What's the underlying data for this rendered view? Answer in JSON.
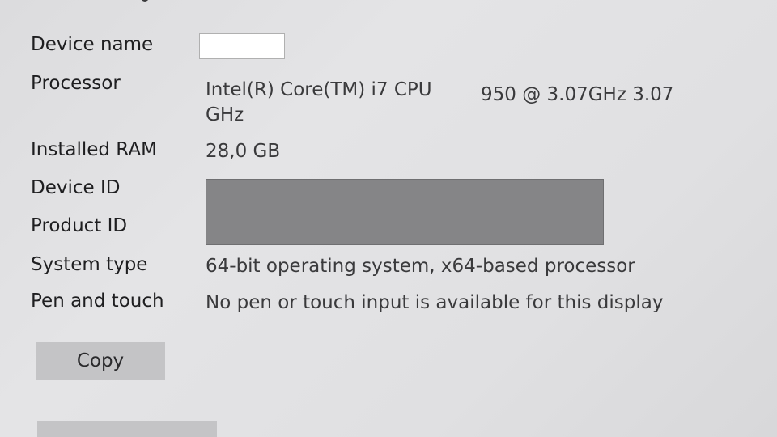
{
  "specs": {
    "device_name": {
      "label": "Device name",
      "value": ""
    },
    "processor": {
      "label": "Processor",
      "value_line1": "Intel(R) Core(TM) i7 CPU",
      "value_suffix": "950  @ 3.07GHz   3.07",
      "value_line2": "GHz"
    },
    "installed_ram": {
      "label": "Installed RAM",
      "value": "28,0 GB"
    },
    "device_id": {
      "label": "Device ID"
    },
    "product_id": {
      "label": "Product ID"
    },
    "system_type": {
      "label": "System type",
      "value": "64-bit operating system, x64-based processor"
    },
    "pen_touch": {
      "label": "Pen and touch",
      "value": "No pen or touch input is available for this display"
    }
  },
  "buttons": {
    "copy_label": "Copy"
  }
}
